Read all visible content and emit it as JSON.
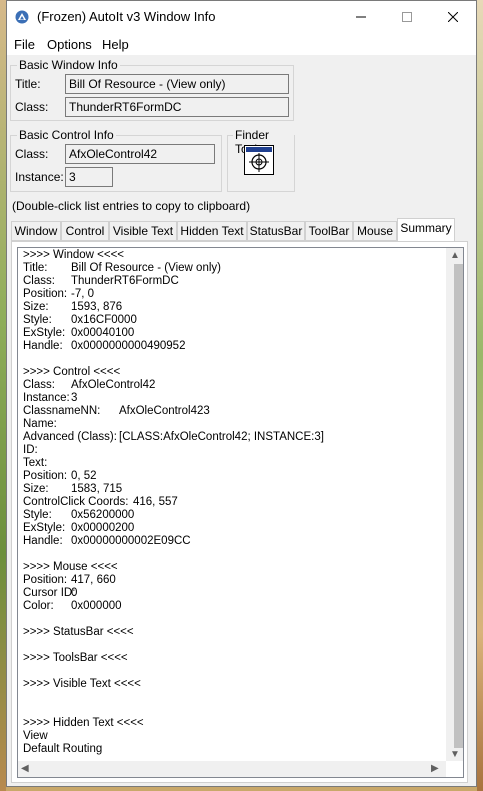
{
  "window": {
    "title": "(Frozen) AutoIt v3 Window Info",
    "menu": [
      "File",
      "Options",
      "Help"
    ]
  },
  "basic_window": {
    "group_label": "Basic Window Info",
    "title_label": "Title:",
    "title_value": "Bill Of Resource - (View only)",
    "class_label": "Class:",
    "class_value": "ThunderRT6FormDC"
  },
  "basic_control": {
    "group_label": "Basic Control Info",
    "class_label": "Class:",
    "class_value": "AfxOleControl42",
    "instance_label": "Instance:",
    "instance_value": "3"
  },
  "finder": {
    "group_label": "Finder Tool"
  },
  "hint": "(Double-click list entries to copy to clipboard)",
  "tabs": [
    "Window",
    "Control",
    "Visible Text",
    "Hidden Text",
    "StatusBar",
    "ToolBar",
    "Mouse",
    "Summary"
  ],
  "active_tab": "Summary",
  "summary": {
    "window_header": ">>>> Window <<<<",
    "window_rows": [
      {
        "k": "Title:",
        "v": "Bill Of Resource - (View only)"
      },
      {
        "k": "Class:",
        "v": "ThunderRT6FormDC"
      },
      {
        "k": "Position:",
        "v": "-7, 0"
      },
      {
        "k": "Size:",
        "v": "1593, 876"
      },
      {
        "k": "Style:",
        "v": "0x16CF0000"
      },
      {
        "k": "ExStyle:",
        "v": "0x00040100"
      },
      {
        "k": "Handle:",
        "v": "0x0000000000490952"
      }
    ],
    "control_header": ">>>> Control <<<<",
    "control_rows": [
      {
        "k": "Class:",
        "v": "AfxOleControl42"
      },
      {
        "k": "Instance:",
        "v": "3"
      },
      {
        "k": "ClassnameNN:",
        "v": "AfxOleControl423"
      },
      {
        "k": "Name:",
        "v": ""
      },
      {
        "k": "Advanced (Class):",
        "v": "[CLASS:AfxOleControl42; INSTANCE:3]"
      },
      {
        "k": "ID:",
        "v": ""
      },
      {
        "k": "Text:",
        "v": ""
      },
      {
        "k": "Position:",
        "v": "0, 52"
      },
      {
        "k": "Size:",
        "v": "1583, 715"
      },
      {
        "k": "ControlClick Coords:",
        "v": "416, 557"
      },
      {
        "k": "Style:",
        "v": "0x56200000"
      },
      {
        "k": "ExStyle:",
        "v": "0x00000200"
      },
      {
        "k": "Handle:",
        "v": "0x00000000002E09CC"
      }
    ],
    "mouse_header": ">>>> Mouse <<<<",
    "mouse_rows": [
      {
        "k": "Position:",
        "v": "417, 660"
      },
      {
        "k": "Cursor ID:",
        "v": "0"
      },
      {
        "k": "Color:",
        "v": "0x000000"
      }
    ],
    "statusbar_header": ">>>> StatusBar <<<<",
    "toolsbar_header": ">>>> ToolsBar <<<<",
    "visible_text_header": ">>>> Visible Text <<<<",
    "hidden_text_header": ">>>> Hidden Text <<<<",
    "hidden_text_lines": [
      "View",
      "Default Routing"
    ]
  }
}
